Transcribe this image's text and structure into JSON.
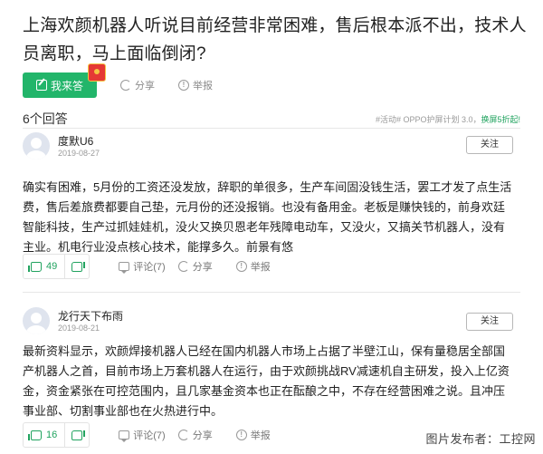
{
  "question": {
    "title": "上海欢颜机器人听说目前经营非常困难，售后根本派不出，技术人员离职，马上面临倒闭?",
    "answer_button": "我来答",
    "share": "分享",
    "report": "举报"
  },
  "answers_header": {
    "count": "6个回答",
    "promo_prefix": "#活动# OPPO护屏计划 3.0，",
    "promo_highlight": "换屏5折起!"
  },
  "answers": [
    {
      "username": "度默U6",
      "date": "2019-08-27",
      "follow": "关注",
      "content": "确实有困难，5月份的工资还没发放，辞职的单很多，生产车间固没钱生活，罢工才发了点生活费，售后差旅费都要自己垫，元月份的还没报销。也没有备用金。老板是赚快钱的，前身欢廷智能科技，生产过抓娃娃机，没火又换贝恩老年残障电动车，又没火，又搞关节机器人，没有主业。机电行业没点核心技术，能撑多久。前景有悠",
      "votes": "49",
      "comment": "评论(7)",
      "share": "分享",
      "report": "举报"
    },
    {
      "username": "龙行天下布雨",
      "date": "2019-08-21",
      "follow": "关注",
      "content": "最新资料显示，欢颜焊接机器人已经在国内机器人市场上占据了半壁江山，保有量稳居全部国产机器人之首，目前市场上万套机器人在运行，由于欢颜挑战RV减速机自主研发，投入上亿资金，资金紧张在可控范围内，且几家基金资本也正在酝酿之中，不存在经营困难之说。且冲压事业部、切割事业部也在火热进行中。",
      "votes": "16",
      "comment": "评论(7)",
      "share": "分享",
      "report": "举报"
    }
  ],
  "watermark": "图片发布者：工控网",
  "colors": {
    "accent_green": "#22b56a",
    "text": "#222222",
    "muted": "#9a9a9a"
  }
}
